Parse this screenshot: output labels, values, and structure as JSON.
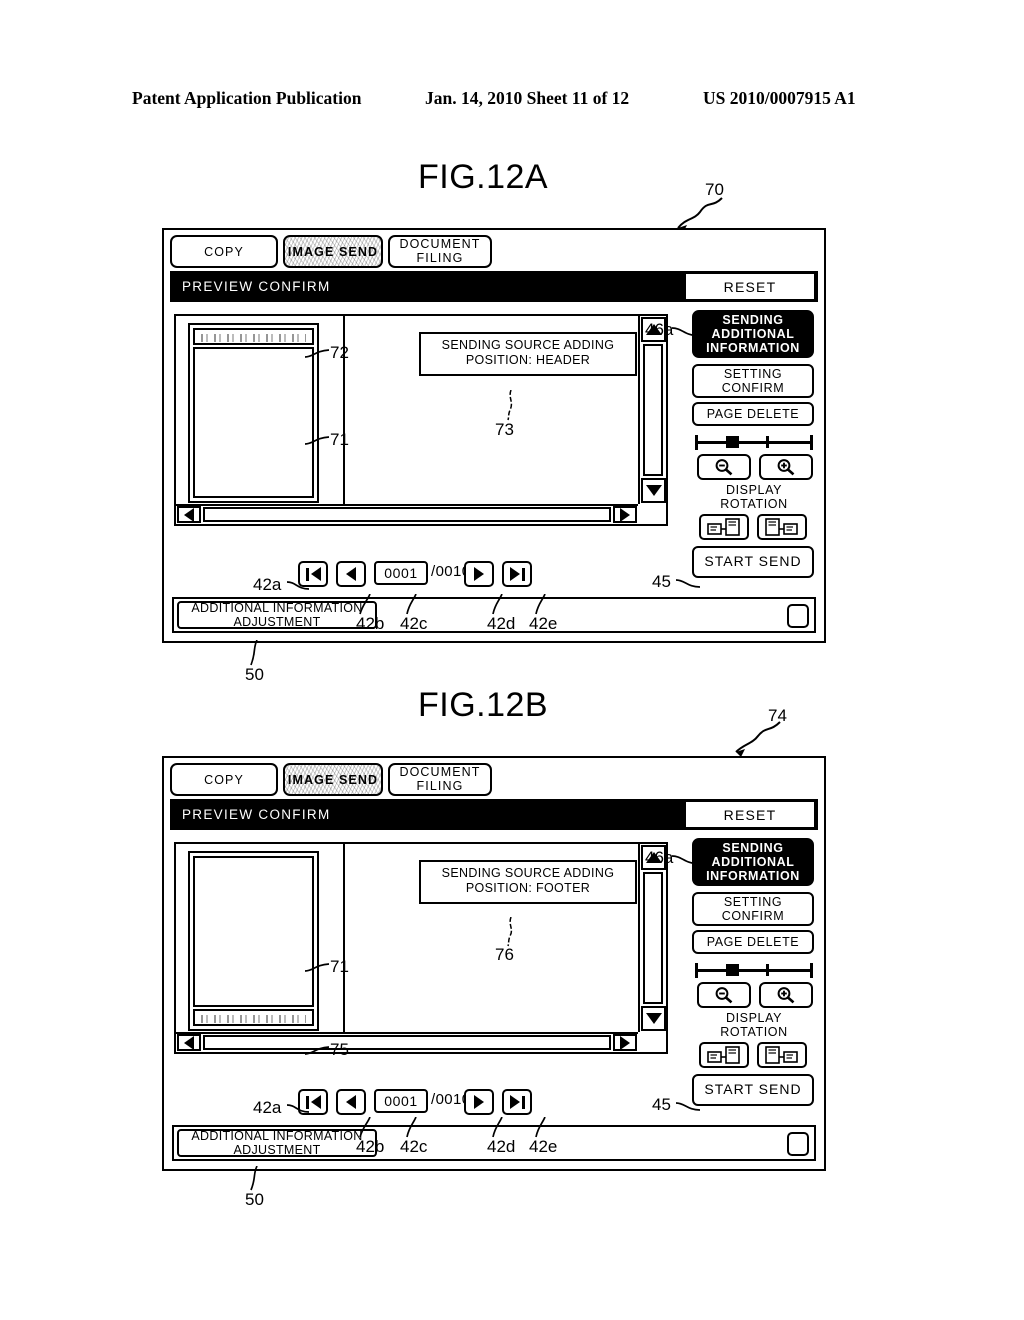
{
  "patent_header": {
    "publication": "Patent Application Publication",
    "date_sheet": "Jan. 14, 2010  Sheet 11 of 12",
    "number": "US 2010/0007915 A1"
  },
  "figures": [
    {
      "id": "a",
      "title": "FIG.12A",
      "panel_ref": "70",
      "tabs": [
        {
          "label": "COPY",
          "selected": false
        },
        {
          "label": "IMAGE SEND",
          "selected": true
        },
        {
          "label": "DOCUMENT FILING",
          "line1": "DOCUMENT",
          "line2": "FILING",
          "selected": false
        }
      ],
      "titlebar": {
        "label": "PREVIEW CONFIRM",
        "reset_label": "RESET"
      },
      "callout": {
        "line1": "SENDING SOURCE ADDING",
        "line2": "POSITION: HEADER",
        "ref": "73"
      },
      "thumbnail": {
        "band_position": "header",
        "band_ref": "72",
        "page_ref": "71"
      },
      "side_buttons": {
        "sending": {
          "line1": "SENDING",
          "line2": "ADDITIONAL",
          "line3": "INFORMATION",
          "ref": "46a",
          "selected": true
        },
        "setting": {
          "line1": "SETTING",
          "line2": "CONFIRM"
        },
        "page_delete": {
          "label": "PAGE DELETE"
        },
        "zoom_out": "zoom-out-icon",
        "zoom_in": "zoom-in-icon",
        "display_rotation": {
          "line1": "DISPLAY",
          "line2": "ROTATION"
        },
        "start_send": {
          "label": "START SEND",
          "ref": "45"
        }
      },
      "pager": {
        "first_ref": "42a",
        "prev_ref": "42b",
        "current_ref": "42c",
        "next_ref": "42d",
        "last_ref": "42e",
        "current_page": "0001",
        "total_pages": "/0010"
      },
      "bottom": {
        "adjust_button": {
          "line1": "ADDITIONAL INFORMATION",
          "line2": "ADJUSTMENT",
          "ref": "50"
        }
      }
    },
    {
      "id": "b",
      "title": "FIG.12B",
      "panel_ref": "74",
      "tabs": [
        {
          "label": "COPY",
          "selected": false
        },
        {
          "label": "IMAGE SEND",
          "selected": true
        },
        {
          "label": "DOCUMENT FILING",
          "line1": "DOCUMENT",
          "line2": "FILING",
          "selected": false
        }
      ],
      "titlebar": {
        "label": "PREVIEW CONFIRM",
        "reset_label": "RESET"
      },
      "callout": {
        "line1": "SENDING SOURCE ADDING",
        "line2": "POSITION: FOOTER",
        "ref": "76"
      },
      "thumbnail": {
        "band_position": "footer",
        "band_ref": "75",
        "page_ref": "71"
      },
      "side_buttons": {
        "sending": {
          "line1": "SENDING",
          "line2": "ADDITIONAL",
          "line3": "INFORMATION",
          "ref": "46a",
          "selected": true
        },
        "setting": {
          "line1": "SETTING",
          "line2": "CONFIRM"
        },
        "page_delete": {
          "label": "PAGE DELETE"
        },
        "zoom_out": "zoom-out-icon",
        "zoom_in": "zoom-in-icon",
        "display_rotation": {
          "line1": "DISPLAY",
          "line2": "ROTATION"
        },
        "start_send": {
          "label": "START SEND",
          "ref": "45"
        }
      },
      "pager": {
        "first_ref": "42a",
        "prev_ref": "42b",
        "current_ref": "42c",
        "next_ref": "42d",
        "last_ref": "42e",
        "current_page": "0001",
        "total_pages": "/0010"
      },
      "bottom": {
        "adjust_button": {
          "line1": "ADDITIONAL INFORMATION",
          "line2": "ADJUSTMENT",
          "ref": "50"
        }
      }
    }
  ]
}
